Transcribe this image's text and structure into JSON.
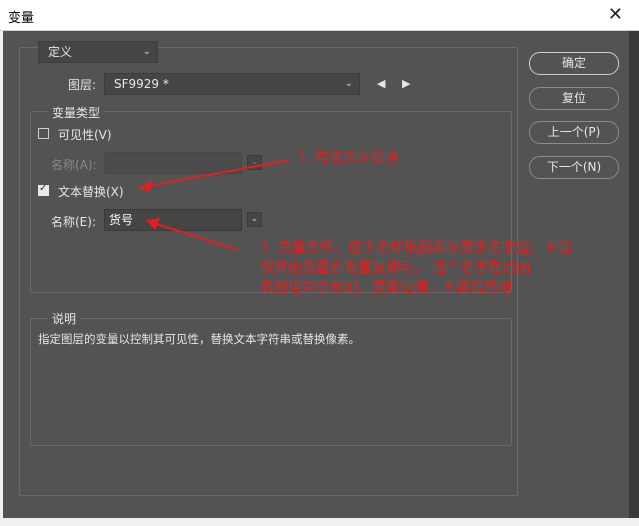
{
  "window": {
    "title": "变量",
    "close": "✕"
  },
  "mode_select": {
    "value": "定义"
  },
  "layer": {
    "label": "图层:",
    "value": "SF9929 *"
  },
  "variable_type": {
    "heading": "变量类型",
    "visibility": {
      "label": "可见性(V)",
      "checked": false
    },
    "name_a_label": "名称(A):",
    "text_replace": {
      "label": "文本替换(X)",
      "checked": true
    },
    "name_e_label": "名称(E):",
    "name_e_value": "货号"
  },
  "description": {
    "heading": "说明",
    "text": "指定图层的变量以控制其可见性，替换文本字符串或替换像素。"
  },
  "buttons": {
    "ok": "确定",
    "reset": "复位",
    "prev": "上一个(P)",
    "next": "下一个(N)"
  },
  "annotations": {
    "note1": "1. 勾选文本替换",
    "note2_line1": "2.  变量名称，这个名称根据实际需求名字起，不能",
    "note2_line2": "跟其他变量名有重复即可。 这个名字在后面",
    "note2_line3": "数据组中会用到，需要记得，不要搞错哦"
  },
  "colors": {
    "annotation": "#e02020",
    "background": "#535353"
  }
}
